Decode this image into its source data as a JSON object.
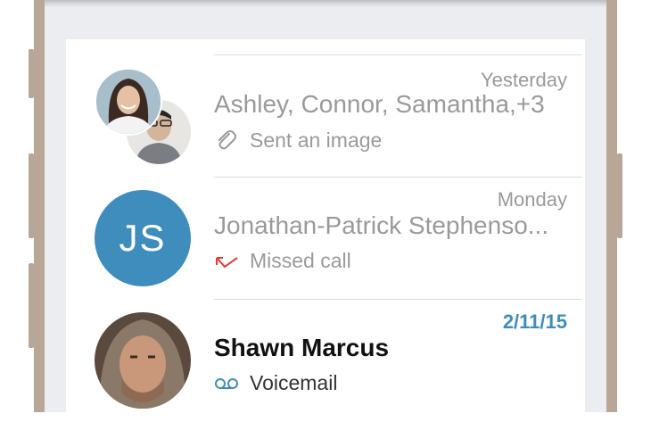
{
  "colors": {
    "accent": "#3f8dbd",
    "muted_text": "#9a9a9a",
    "missed_call": "#e53935",
    "frame": "#b8a797"
  },
  "conversations": [
    {
      "date": "Yesterday",
      "name": "Ashley, Connor, Samantha,+3",
      "preview": "Sent an image",
      "icon": "paperclip-icon",
      "avatar": "group-avatar"
    },
    {
      "date": "Monday",
      "name": "Jonathan-Patrick Stephenso...",
      "initials": "JS",
      "preview": "Missed call",
      "icon": "missed-call-icon",
      "avatar": "initials-avatar"
    },
    {
      "date": "2/11/15",
      "name": "Shawn Marcus",
      "preview": "Voicemail",
      "icon": "voicemail-icon",
      "avatar": "photo-avatar",
      "unread": true
    }
  ]
}
